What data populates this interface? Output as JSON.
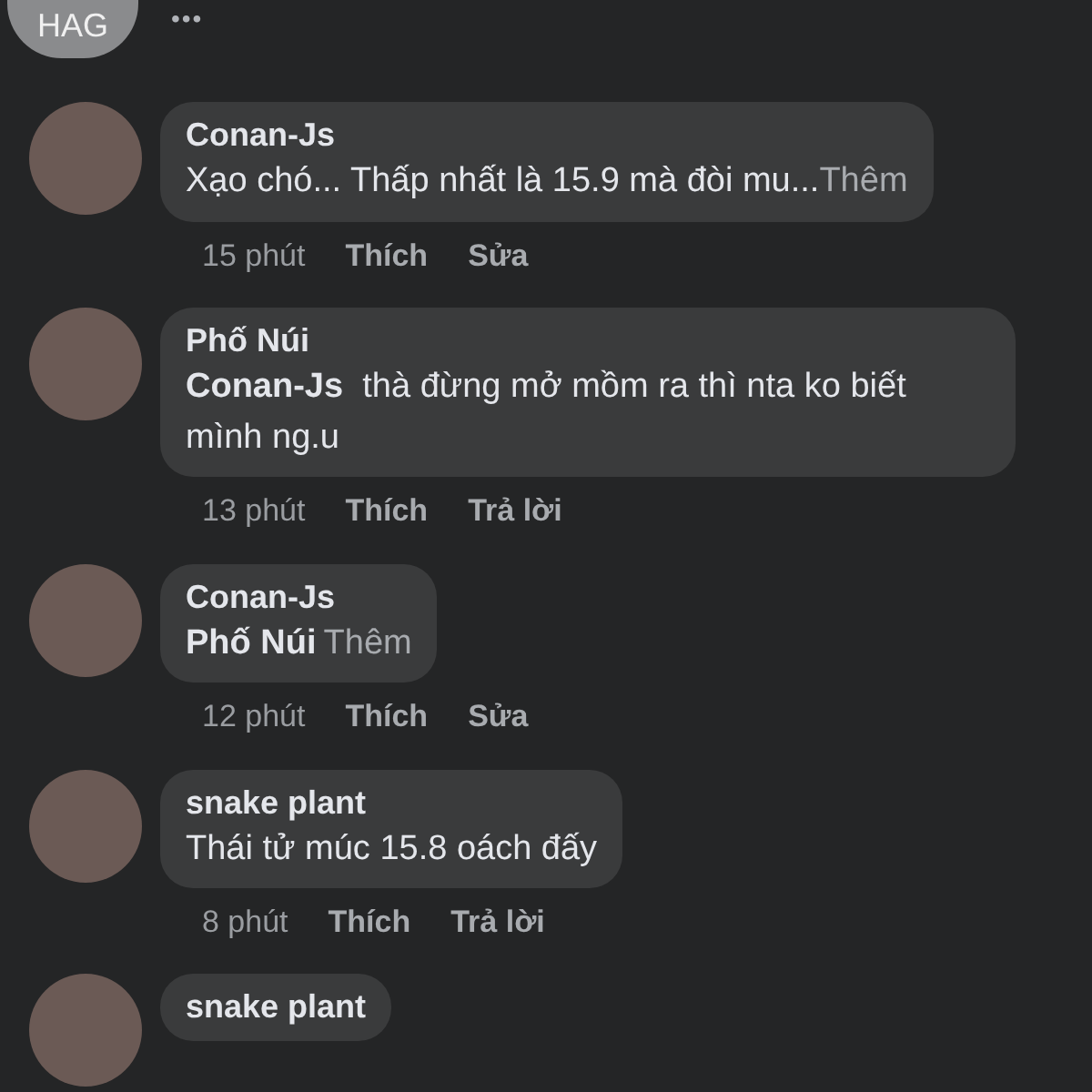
{
  "header": {
    "chip": "HAG",
    "more": "•••"
  },
  "comments": [
    {
      "author": "Conan-Js",
      "text": "Xạo chó... Thấp nhất là 15.9 mà đòi mu...",
      "more": "Thêm",
      "time": "15 phút",
      "actions": [
        "Thích",
        "Sửa"
      ]
    },
    {
      "author": "Phố Núi",
      "mention": "Conan-Js",
      "text": "thà đừng mở mồm ra thì nta ko biết mình ng.u",
      "time": "13 phút",
      "actions": [
        "Thích",
        "Trả lời"
      ]
    },
    {
      "author": "Conan-Js",
      "mention": "Phố Núi",
      "more": "Thêm",
      "time": "12 phút",
      "actions": [
        "Thích",
        "Sửa"
      ]
    },
    {
      "author": "snake plant",
      "text": "Thái tử múc 15.8 oách đấy",
      "time": "8 phút",
      "actions": [
        "Thích",
        "Trả lời"
      ]
    },
    {
      "author": "snake plant"
    }
  ]
}
